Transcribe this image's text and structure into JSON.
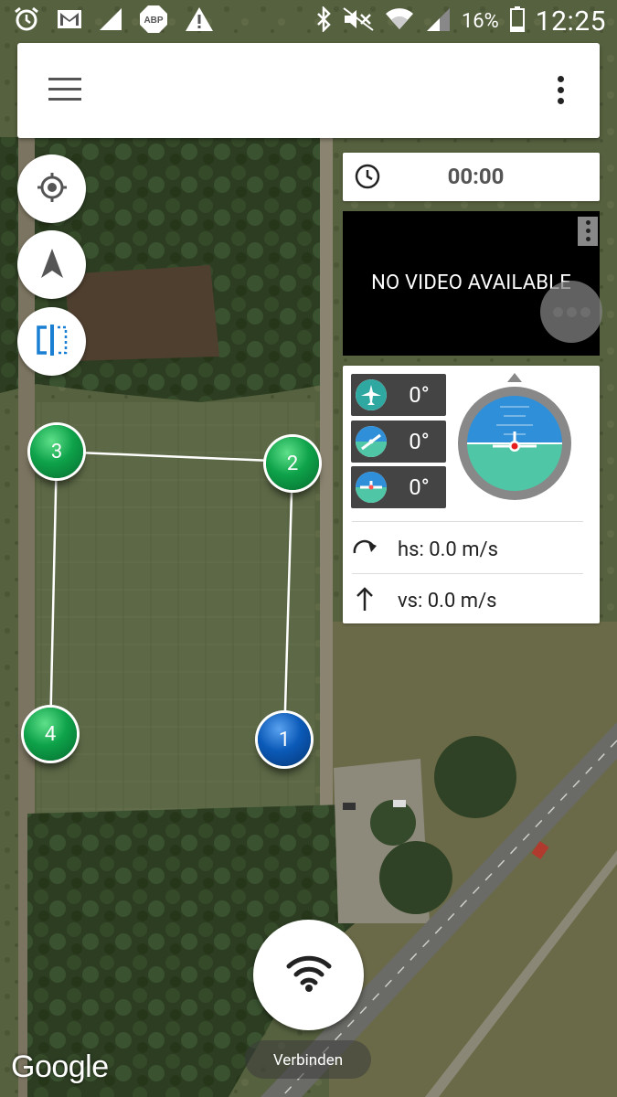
{
  "status_bar": {
    "battery": "16%",
    "time": "12:25",
    "left_icons": [
      "alarm-icon",
      "gmail-icon",
      "signal-cutout-icon",
      "adblock-icon",
      "warning-icon"
    ],
    "right_icons": [
      "bluetooth-icon",
      "mute-icon",
      "wifi-icon",
      "cell-signal-icon",
      "battery-icon"
    ]
  },
  "toolbar": {
    "menu_icon": "menu-icon",
    "overflow_icon": "more-vert-icon"
  },
  "map_controls": [
    {
      "name": "my-location-button",
      "icon": "crosshair-icon"
    },
    {
      "name": "navigation-button",
      "icon": "navigation-arrow-icon"
    },
    {
      "name": "split-view-button",
      "icon": "split-view-icon"
    }
  ],
  "flight_timer": {
    "icon": "clock-icon",
    "value": "00:00"
  },
  "video": {
    "message": "NO VIDEO AVAILABLE"
  },
  "attitude": {
    "yaw": "0°",
    "pitch": "0°",
    "roll": "0°",
    "horizon_sky": "#2f8fd8",
    "horizon_ground": "#4fc6a6",
    "bezel": "#7a7a7a"
  },
  "speeds": {
    "horizontal": "hs: 0.0 m/s",
    "vertical": "vs: 0.0 m/s"
  },
  "waypoints": [
    {
      "label": "1",
      "color": "blue"
    },
    {
      "label": "2",
      "color": "green"
    },
    {
      "label": "3",
      "color": "green"
    },
    {
      "label": "4",
      "color": "green"
    }
  ],
  "connect": {
    "icon": "wifi-signal-icon",
    "label": "Verbinden"
  },
  "attribution": "Google"
}
